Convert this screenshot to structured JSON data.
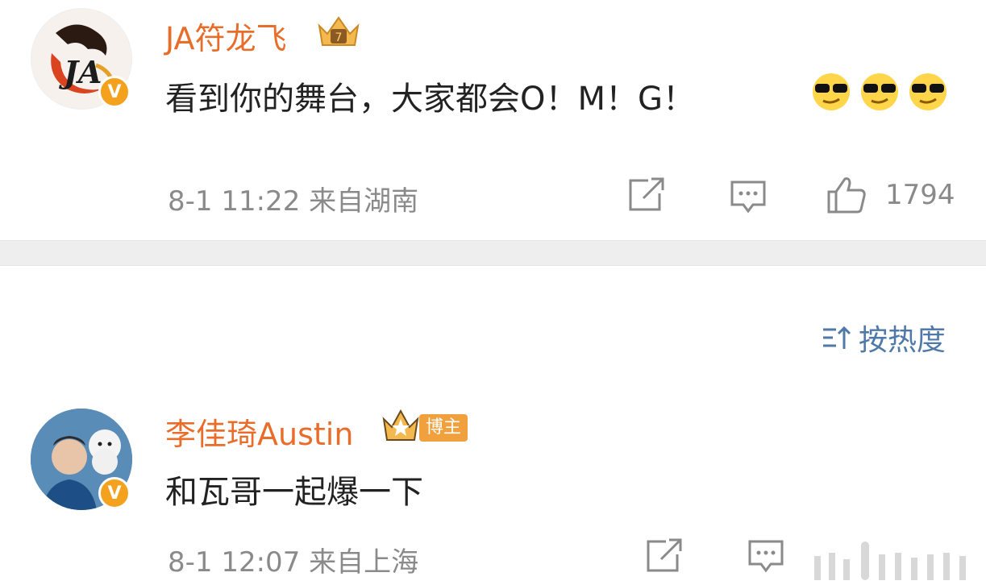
{
  "comments": [
    {
      "username": "JA符龙飞",
      "text": "看到你的舞台，大家都会O！M！G！",
      "emojis": [
        "sunglasses-emoji",
        "sunglasses-emoji",
        "sunglasses-emoji"
      ],
      "meta": "8-1 11:22 来自湖南",
      "likes": "1794",
      "verified": "V"
    },
    {
      "username": "李佳琦Austin",
      "badge": "博主",
      "text": "和瓦哥一起爆一下",
      "meta": "8-1 12:07 来自上海",
      "verified": "V"
    }
  ],
  "sort": {
    "label": "按热度"
  },
  "colors": {
    "username": "#e86d2b",
    "link": "#4f79a8",
    "meta": "#8a8a8a",
    "badge": "#f4a11e",
    "divider": "#eeeeee"
  }
}
